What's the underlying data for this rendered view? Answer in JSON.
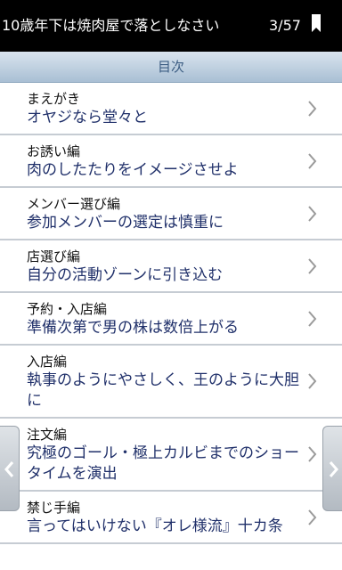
{
  "header": {
    "title": "10歳年下は焼肉屋で落としなさい",
    "page_indicator": "3/57",
    "bookmark_icon": "bookmark-icon"
  },
  "toc": {
    "heading": "目次",
    "items": [
      {
        "chapter": "まえがき",
        "title": "オヤジなら堂々と"
      },
      {
        "chapter": "お誘い編",
        "title": "肉のしたたりをイメージさせよ"
      },
      {
        "chapter": "メンバー選び編",
        "title": "参加メンバーの選定は慎重に"
      },
      {
        "chapter": "店選び編",
        "title": "自分の活動ゾーンに引き込む"
      },
      {
        "chapter": "予約・入店編",
        "title": "準備次第で男の株は数倍上がる"
      },
      {
        "chapter": "入店編",
        "title": "執事のようにやさしく、王のように大胆に"
      },
      {
        "chapter": "注文編",
        "title": "究極のゴール・極上カルビまでのショータイムを演出"
      },
      {
        "chapter": "禁じ手編",
        "title": "言ってはいけない『オレ様流』十カ条"
      }
    ]
  },
  "nav": {
    "prev_icon": "chevron-left-icon",
    "next_icon": "chevron-right-icon"
  },
  "colors": {
    "topbar": "#000000",
    "toc_header_text": "#3b5c82",
    "item_title": "#20306a",
    "chevron": "#9a9a9a"
  }
}
